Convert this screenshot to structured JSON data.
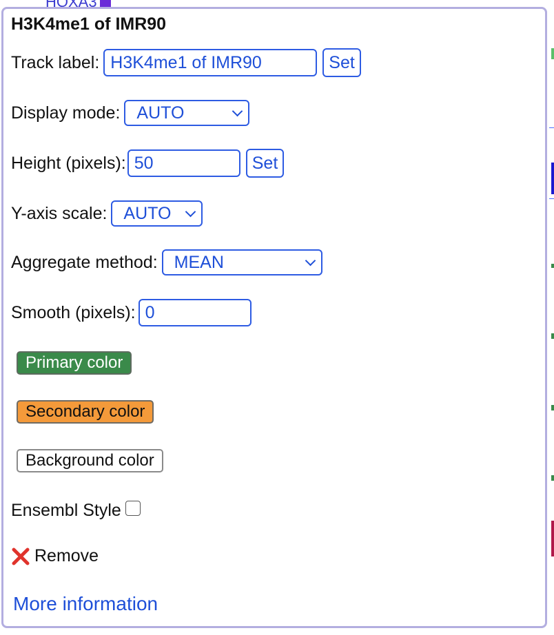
{
  "background": {
    "header_fragment": "HOXA3"
  },
  "menu": {
    "title": "H3K4me1 of IMR90",
    "track_label": {
      "label": "Track label:",
      "value": "H3K4me1 of IMR90",
      "set_label": "Set"
    },
    "display_mode": {
      "label": "Display mode:",
      "selected": "AUTO"
    },
    "height": {
      "label": "Height (pixels):",
      "value": "50",
      "set_label": "Set"
    },
    "y_axis_scale": {
      "label": "Y-axis scale:",
      "selected": "AUTO"
    },
    "aggregate_method": {
      "label": "Aggregate method:",
      "selected": "MEAN"
    },
    "smooth": {
      "label": "Smooth (pixels):",
      "value": "0"
    },
    "primary_color": {
      "label": "Primary color",
      "bg": "#3a8a4a",
      "fg": "#ffffff"
    },
    "secondary_color": {
      "label": "Secondary color",
      "bg": "#f49a3a",
      "fg": "#111111"
    },
    "background_color": {
      "label": "Background color",
      "bg": "#ffffff",
      "fg": "#111111"
    },
    "ensembl_style": {
      "label": "Ensembl Style",
      "checked": false
    },
    "remove": {
      "label": "Remove",
      "icon": "x-mark-icon",
      "icon_color": "#e0332c"
    },
    "more_info": {
      "label": "More information"
    }
  },
  "colors": {
    "accent": "#2d5be3",
    "menu_border": "#b3aee0"
  }
}
